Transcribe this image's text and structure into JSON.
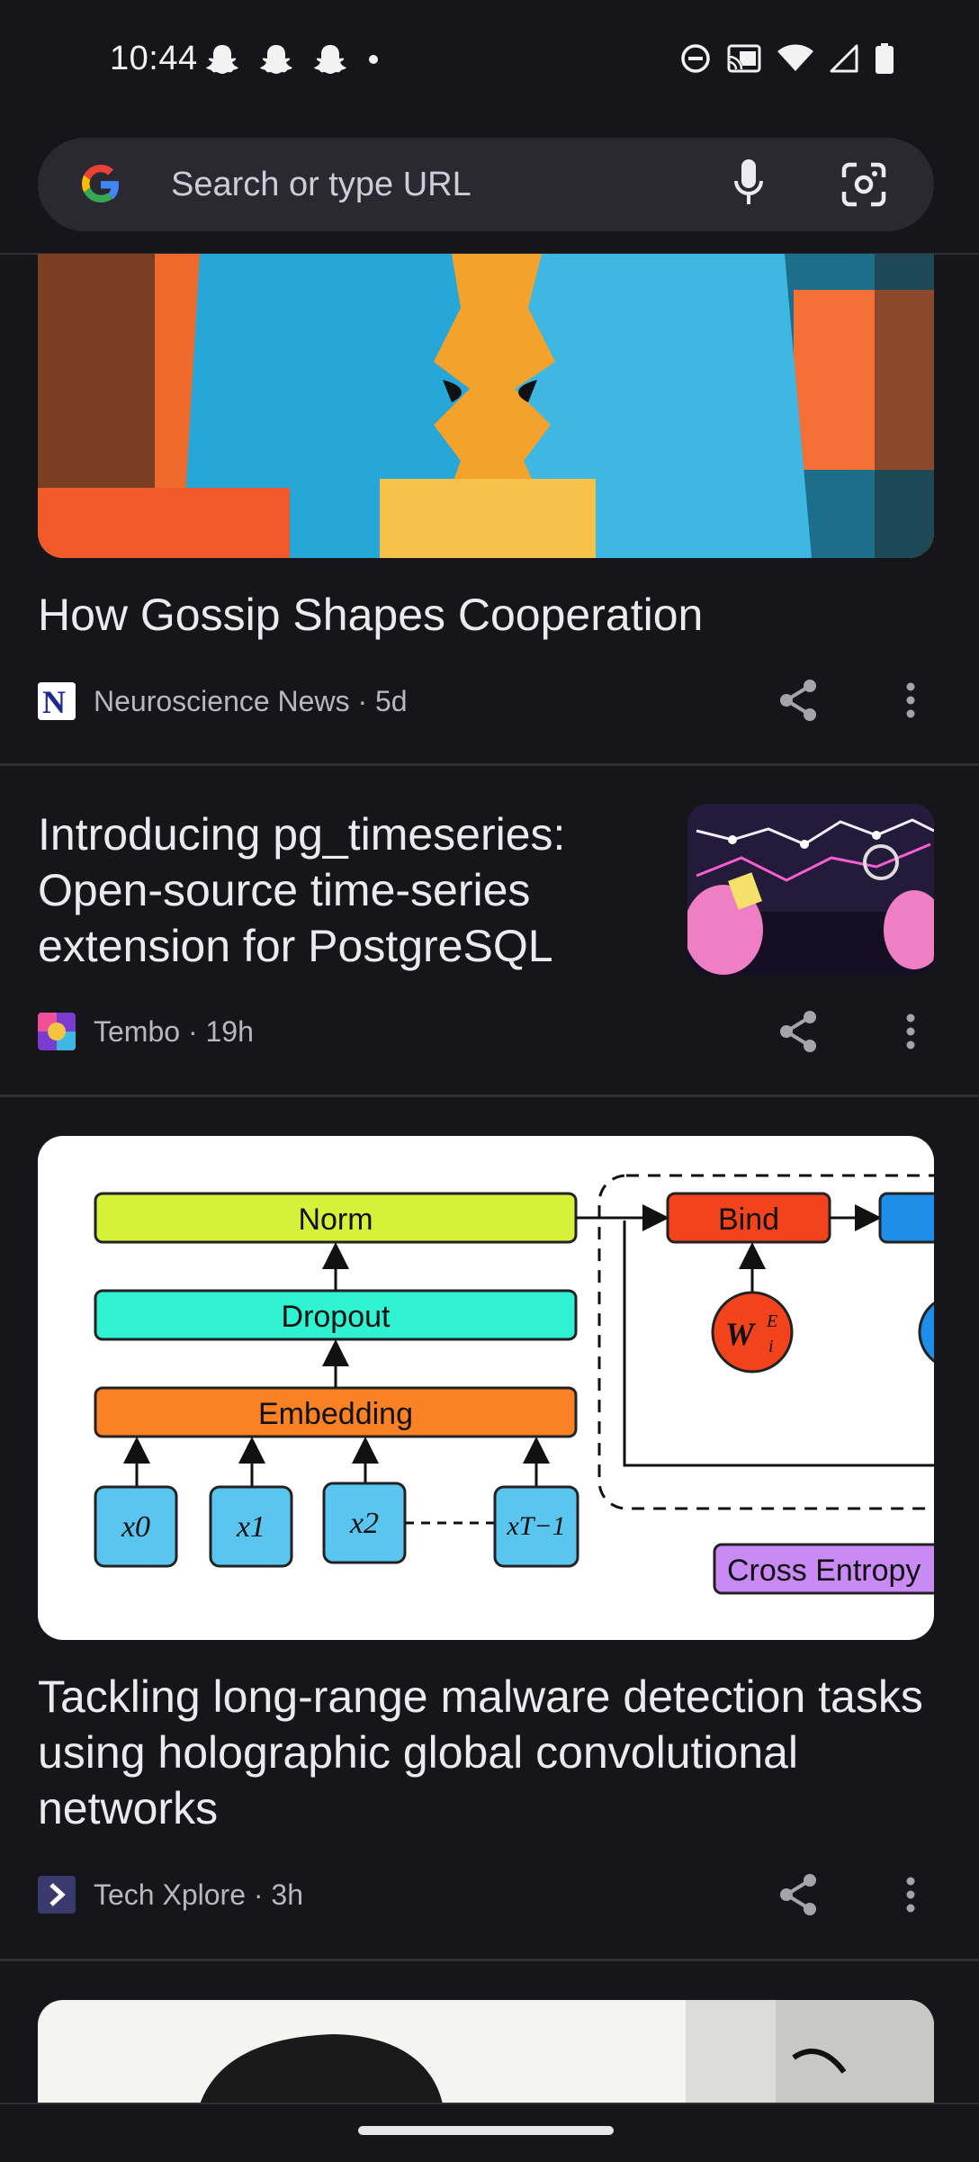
{
  "status_bar": {
    "time": "10:44",
    "notification_icons": [
      "snapchat-icon",
      "snapchat-icon",
      "snapchat-icon",
      "dot-icon"
    ],
    "system_icons": [
      "do-not-disturb-icon",
      "cast-icon",
      "wifi-icon",
      "signal-icon",
      "battery-icon"
    ]
  },
  "search": {
    "placeholder": "Search or type URL",
    "icons": [
      "google-logo",
      "mic-icon",
      "lens-icon"
    ]
  },
  "feed": {
    "articles": [
      {
        "title": "How Gossip Shapes Cooperation",
        "source": "Neuroscience News",
        "age": "5d",
        "meta": "Neuroscience News · 5d",
        "image": "illustration of two facing profiles"
      },
      {
        "title": "Introducing pg_timeseries: Open-source time-series extension for PostgreSQL",
        "source": "Tembo",
        "age": "19h",
        "meta": "Tembo · 19h",
        "image": "thumbnail with elephants and line chart"
      },
      {
        "title": "Tackling long-range malware detection tasks using holographic global convolutional networks",
        "source": "Tech Xplore",
        "age": "3h",
        "meta": "Tech Xplore · 3h",
        "diagram": {
          "boxes": [
            "Norm",
            "Dropout",
            "Embedding",
            "Bind",
            "Cross Entropy"
          ],
          "inputs": [
            "x0",
            "x1",
            "x2",
            "xT−1"
          ],
          "weight": "W"
        }
      }
    ]
  },
  "colors": {
    "background": "#16161a",
    "search_bar": "#2a2932",
    "norm": "#d7f03a",
    "dropout": "#2ef2d2",
    "embedding": "#fb8125",
    "bind": "#f2431d",
    "input": "#5ac6f0",
    "cross_entropy": "#c98af5"
  }
}
